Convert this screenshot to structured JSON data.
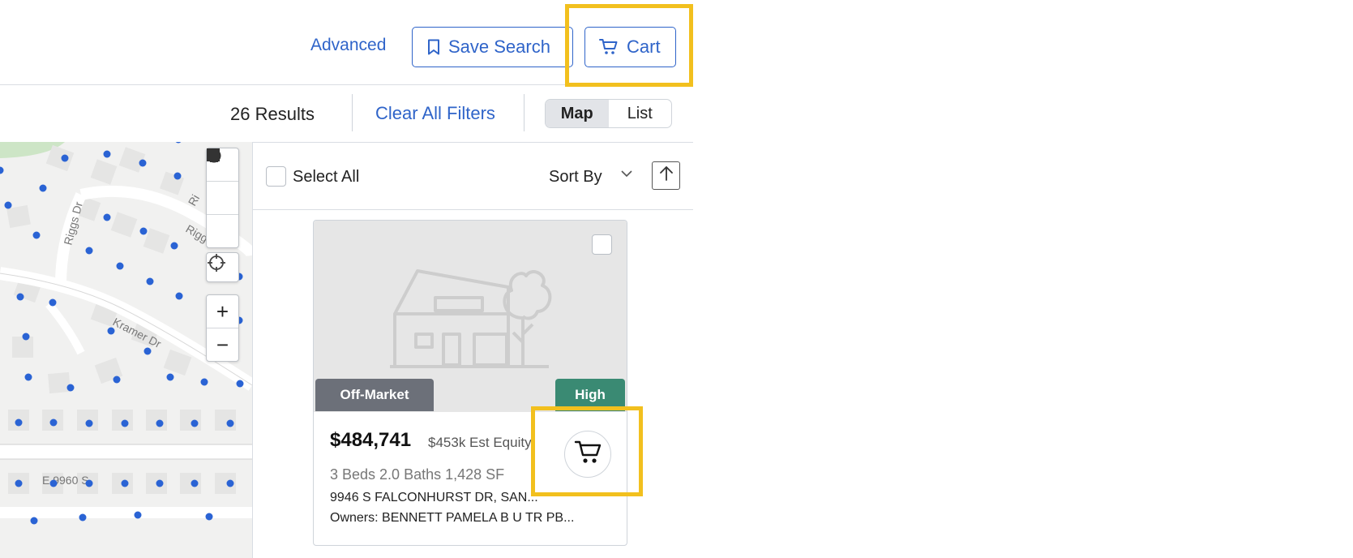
{
  "header": {
    "advanced_label": "Advanced",
    "save_search_label": "Save Search",
    "cart_label": "Cart"
  },
  "results_bar": {
    "results_count": "26 Results",
    "clear_filters_label": "Clear All Filters",
    "view_toggle": {
      "map_label": "Map",
      "list_label": "List",
      "active": "Map"
    }
  },
  "map": {
    "street_labels": [
      "Riggs Dr",
      "Kramer Dr",
      "E 9960 S",
      "Ri",
      "Rigg"
    ],
    "controls": [
      "polygon-draw",
      "rectangle-draw",
      "circle-draw",
      "locate",
      "zoom-in",
      "zoom-out"
    ],
    "zoom_in_label": "+",
    "zoom_out_label": "−"
  },
  "list": {
    "select_all_label": "Select All",
    "sort_by_label": "Sort By"
  },
  "card": {
    "status_tag": "Off-Market",
    "equity_tag": "High",
    "price": "$484,741",
    "est_equity": "$453k Est Equity",
    "stats": "3 Beds 2.0 Baths 1,428 SF",
    "address": "9946 S FALCONHURST DR, SAN...",
    "owners": "Owners: BENNETT PAMELA B U TR PB..."
  },
  "colors": {
    "accent": "#2f64c9",
    "highlight": "#f2c01e",
    "off_market_tag": "#6c7079",
    "high_tag": "#3a8a73",
    "map_dot": "#2a63d4"
  }
}
